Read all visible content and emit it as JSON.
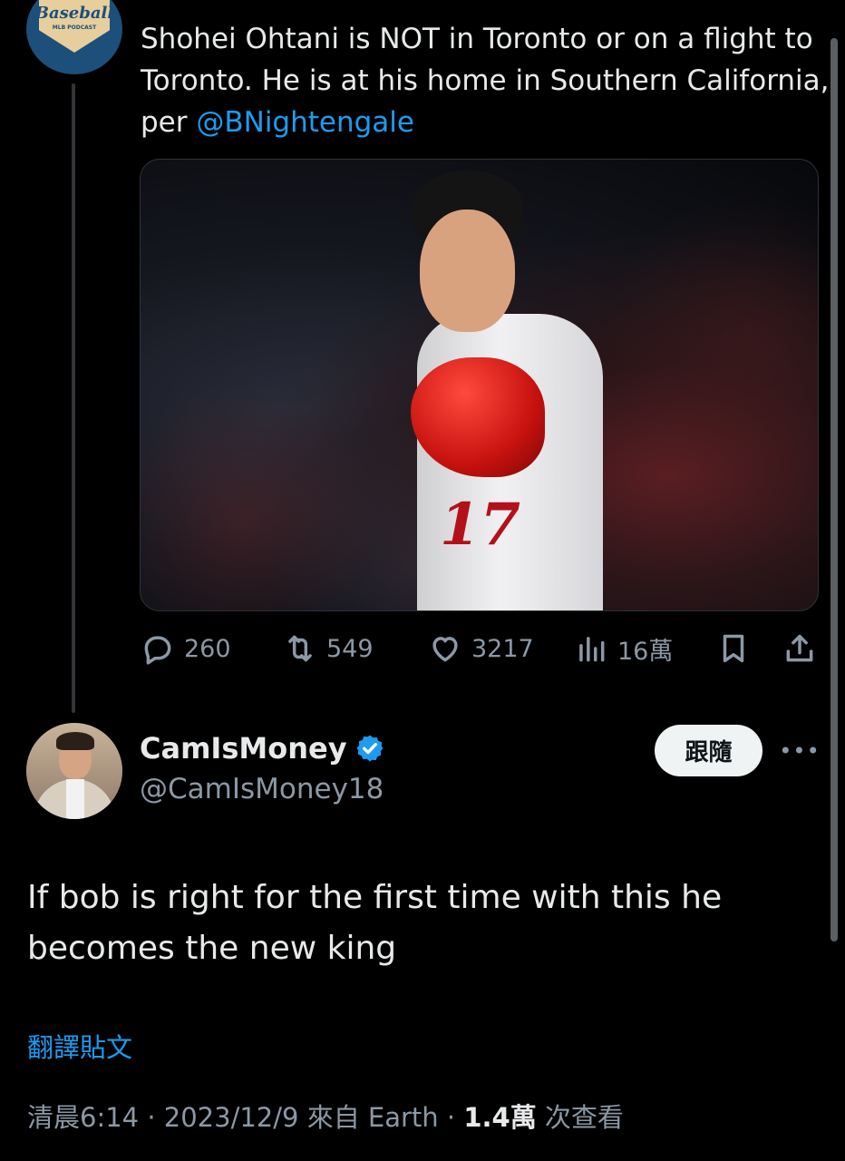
{
  "quoted_tweet": {
    "avatar": {
      "brand": "Baseball",
      "brand_sub": "MLB PODCAST"
    },
    "text_main": "Shohei Ohtani is NOT in Toronto or on a flight to Toronto. He is at his home in Southern California, per ",
    "mention": "@BNightengale",
    "image": {
      "jersey_number": "17"
    },
    "actions": {
      "replies": "260",
      "retweets": "549",
      "likes": "3217",
      "views": "16萬"
    }
  },
  "tweet": {
    "author": {
      "name": "CamIsMoney",
      "handle": "@CamIsMoney18",
      "verified": true
    },
    "follow_label": "跟隨",
    "more_label": "•••",
    "text": "If bob is right for the first time with this he becomes the new king",
    "translate_label": "翻譯貼文",
    "meta": {
      "time_prefix": "清晨6:14 · 2023/12/9 來自 Earth · ",
      "views_count": "1.4萬",
      "views_suffix": " 次查看"
    }
  },
  "colors": {
    "background": "#000000",
    "text": "#e7e9ea",
    "secondary_text": "#8b98a5",
    "accent": "#1d9bf0"
  }
}
